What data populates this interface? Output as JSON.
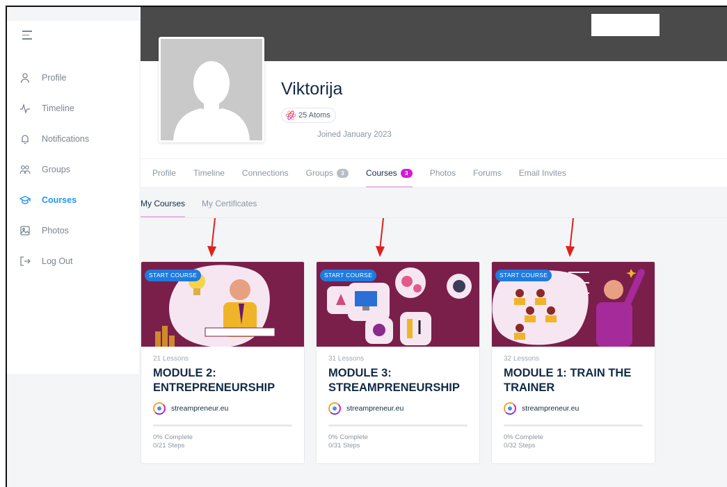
{
  "sidebar": {
    "items": [
      {
        "label": "Profile",
        "icon": "user-icon"
      },
      {
        "label": "Timeline",
        "icon": "activity-icon"
      },
      {
        "label": "Notifications",
        "icon": "bell-icon"
      },
      {
        "label": "Groups",
        "icon": "users-icon"
      },
      {
        "label": "Courses",
        "icon": "graduation-cap-icon",
        "active": true
      },
      {
        "label": "Photos",
        "icon": "image-icon"
      },
      {
        "label": "Log Out",
        "icon": "logout-icon"
      }
    ]
  },
  "profile": {
    "name": "Viktorija",
    "atoms": "25 Atoms",
    "joined": "Joined January 2023"
  },
  "tabs": [
    {
      "label": "Profile"
    },
    {
      "label": "Timeline"
    },
    {
      "label": "Connections"
    },
    {
      "label": "Groups",
      "badge": "3"
    },
    {
      "label": "Courses",
      "badge": "3",
      "active": true
    },
    {
      "label": "Photos"
    },
    {
      "label": "Forums"
    },
    {
      "label": "Email Invites"
    }
  ],
  "subtabs": [
    {
      "label": "My Courses",
      "active": true
    },
    {
      "label": "My Certificates"
    }
  ],
  "courses": [
    {
      "start": "START COURSE",
      "lessons": "21 Lessons",
      "title": "MODULE 2: ENTREPRENEURSHIP",
      "author": "streampreneur.eu",
      "complete": "0% Complete",
      "steps": "0/21 Steps",
      "progress": 0
    },
    {
      "start": "START COURSE",
      "lessons": "31 Lessons",
      "title": "MODULE 3: STREAMPRENEURSHIP",
      "author": "streampreneur.eu",
      "complete": "0% Complete",
      "steps": "0/31 Steps",
      "progress": 0
    },
    {
      "start": "START COURSE",
      "lessons": "32 Lessons",
      "title": "MODULE 1: TRAIN THE TRAINER",
      "author": "streampreneur.eu",
      "complete": "0% Complete",
      "steps": "0/32 Steps",
      "progress": 0
    }
  ],
  "colors": {
    "accent": "#2196f3",
    "badge_active": "#d41bd4",
    "card_bg": "#7a1f4a",
    "arrow": "#e0201b"
  }
}
